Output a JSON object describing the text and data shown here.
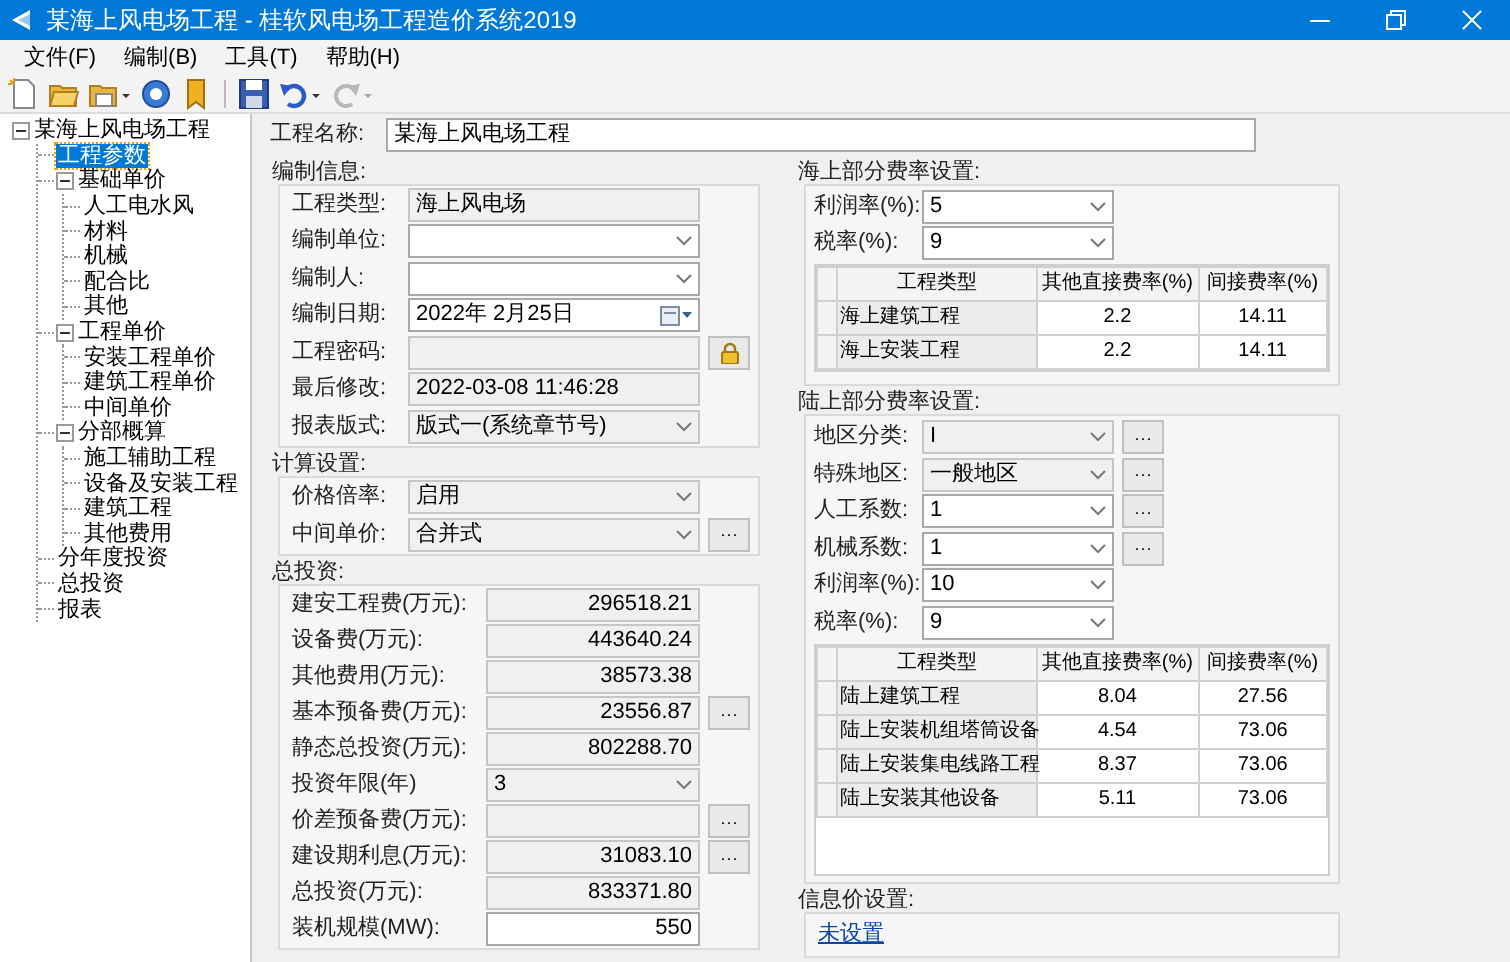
{
  "window": {
    "title": "某海上风电场工程 - 桂软风电场工程造价系统2019"
  },
  "menu": [
    {
      "label": "文件(F)"
    },
    {
      "label": "编制(B)"
    },
    {
      "label": "工具(T)"
    },
    {
      "label": "帮助(H)"
    }
  ],
  "tree": [
    {
      "label": "某海上风电场工程",
      "expanded": true,
      "selected": false,
      "children": [
        {
          "label": "工程参数",
          "selected": true
        },
        {
          "label": "基础单价",
          "expanded": true,
          "selected": false,
          "children": [
            {
              "label": "人工电水风",
              "selected": false
            },
            {
              "label": "材料",
              "selected": false
            },
            {
              "label": "机械",
              "selected": false
            },
            {
              "label": "配合比",
              "selected": false
            },
            {
              "label": "其他",
              "selected": false
            }
          ]
        },
        {
          "label": "工程单价",
          "expanded": true,
          "selected": false,
          "children": [
            {
              "label": "安装工程单价",
              "selected": false
            },
            {
              "label": "建筑工程单价",
              "selected": false
            },
            {
              "label": "中间单价",
              "selected": false
            }
          ]
        },
        {
          "label": "分部概算",
          "expanded": true,
          "selected": false,
          "children": [
            {
              "label": "施工辅助工程",
              "selected": false
            },
            {
              "label": "设备及安装工程",
              "selected": false
            },
            {
              "label": "建筑工程",
              "selected": false
            },
            {
              "label": "其他费用",
              "selected": false
            }
          ]
        },
        {
          "label": "分年度投资",
          "selected": false
        },
        {
          "label": "总投资",
          "selected": false
        },
        {
          "label": "报表",
          "selected": false
        }
      ]
    }
  ],
  "project_name": {
    "label": "工程名称:",
    "kind": "text",
    "value": "某海上风电场工程"
  },
  "compile_info": {
    "title": "编制信息:",
    "fields": [
      {
        "label": "工程类型:",
        "kind": "text",
        "readonly": true,
        "value": "海上风电场"
      },
      {
        "label": "编制单位:",
        "kind": "select",
        "readonly": false
      },
      {
        "label": "编制人:",
        "kind": "select",
        "readonly": false
      },
      {
        "label": "编制日期:",
        "kind": "date",
        "value": "2022年 2月25日"
      },
      {
        "label": "工程密码:",
        "kind": "password"
      },
      {
        "label": "最后修改:",
        "kind": "text",
        "readonly": true,
        "value": "2022-03-08 11:46:28"
      },
      {
        "label": "报表版式:",
        "kind": "select",
        "readonly": true,
        "value": "版式一(系统章节号)"
      }
    ]
  },
  "calc_settings": {
    "title": "计算设置:",
    "fields": [
      {
        "label": "价格倍率:",
        "kind": "select",
        "readonly": true,
        "value": "启用"
      },
      {
        "label": "中间单价:",
        "kind": "select",
        "readonly": true,
        "value": "合并式",
        "button": "···"
      }
    ]
  },
  "total_investment": {
    "title": "总投资:",
    "fields": [
      {
        "label": "建安工程费(万元):",
        "kind": "text",
        "readonly": true,
        "value": "296518.21"
      },
      {
        "label": "设备费(万元):",
        "kind": "text",
        "readonly": true,
        "value": "443640.24"
      },
      {
        "label": "其他费用(万元):",
        "kind": "text",
        "readonly": true,
        "value": "38573.38"
      },
      {
        "label": "基本预备费(万元):",
        "kind": "text",
        "readonly": true,
        "value": "23556.87",
        "button": "···"
      },
      {
        "label": "静态总投资(万元):",
        "kind": "text",
        "readonly": true,
        "value": "802288.70"
      },
      {
        "label": "投资年限(年)",
        "kind": "select",
        "readonly": true,
        "value": "3"
      },
      {
        "label": "价差预备费(万元):",
        "kind": "text",
        "readonly": true,
        "button": "···"
      },
      {
        "label": "建设期利息(万元):",
        "kind": "text",
        "readonly": true,
        "value": "31083.10",
        "button": "···"
      },
      {
        "label": "总投资(万元):",
        "kind": "text",
        "readonly": true,
        "value": "833371.80"
      },
      {
        "label": "装机规模(MW):",
        "kind": "text",
        "readonly": false,
        "value": "550"
      }
    ]
  },
  "offshore_rates": {
    "title": "海上部分费率设置:",
    "fields": [
      {
        "label": "利润率(%):",
        "kind": "select",
        "readonly": false,
        "value": "5"
      },
      {
        "label": "税率(%):",
        "kind": "select",
        "readonly": false,
        "value": "9"
      }
    ],
    "table": {
      "columns": [
        "工程类型",
        "其他直接费率(%)",
        "间接费率(%)"
      ],
      "rows": [
        [
          "海上建筑工程",
          "2.2",
          "14.11"
        ],
        [
          "海上安装工程",
          "2.2",
          "14.11"
        ]
      ]
    }
  },
  "onshore_rates": {
    "title": "陆上部分费率设置:",
    "fields": [
      {
        "label": "地区分类:",
        "kind": "select",
        "readonly": true,
        "value": "I",
        "button": "···"
      },
      {
        "label": "特殊地区:",
        "kind": "select",
        "readonly": true,
        "value": "一般地区",
        "button": "···"
      },
      {
        "label": "人工系数:",
        "kind": "select",
        "readonly": false,
        "value": "1",
        "button": "···"
      },
      {
        "label": "机械系数:",
        "kind": "select",
        "readonly": false,
        "value": "1",
        "button": "···"
      },
      {
        "label": "利润率(%):",
        "kind": "select",
        "readonly": false,
        "value": "10"
      },
      {
        "label": "税率(%):",
        "kind": "select",
        "readonly": false,
        "value": "9"
      }
    ],
    "table": {
      "columns": [
        "工程类型",
        "其他直接费率(%)",
        "间接费率(%)"
      ],
      "rows": [
        [
          "陆上建筑工程",
          "8.04",
          "27.56"
        ],
        [
          "陆上安装机组塔筒设备",
          "4.54",
          "73.06"
        ],
        [
          "陆上安装集电线路工程",
          "8.37",
          "73.06"
        ],
        [
          "陆上安装其他设备",
          "5.11",
          "73.06"
        ]
      ]
    }
  },
  "info_price": {
    "title": "信息价设置:",
    "link": "未设置"
  }
}
